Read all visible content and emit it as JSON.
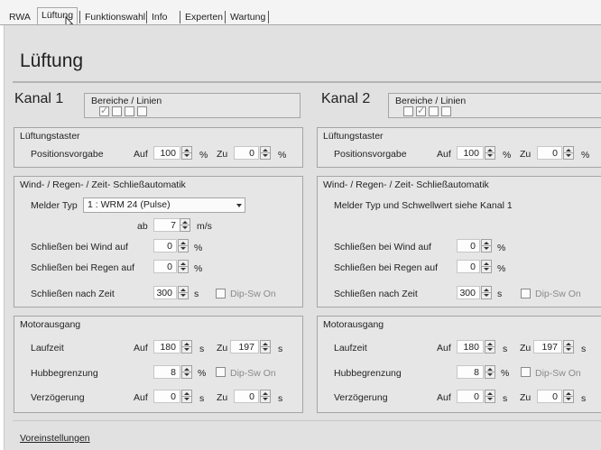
{
  "tabs": [
    "RWA",
    "Lüftung",
    "Funktionswahl",
    "Info",
    "Experten",
    "Wartung"
  ],
  "active_tab": "Lüftung",
  "page_title": "Lüftung",
  "footer_link": "Voreinstellungen",
  "kanal1": {
    "title": "Kanal 1",
    "bereiche_label": "Bereiche / Linien",
    "bereiche_checked": [
      true,
      false,
      false,
      false
    ],
    "lueftungstaster": {
      "title": "Lüftungstaster",
      "positionsvorgabe": "Positionsvorgabe",
      "auf_label": "Auf",
      "auf": "100",
      "auf_unit": "%",
      "zu_label": "Zu",
      "zu": "0",
      "zu_unit": "%"
    },
    "wind": {
      "title": "Wind- / Regen- / Zeit- Schließautomatik",
      "melder_typ_label": "Melder Typ",
      "melder_typ": "1 : WRM 24  (Pulse)",
      "ab_label": "ab",
      "ab": "7",
      "ab_unit": "m/s",
      "wind_label": "Schließen bei Wind auf",
      "wind": "0",
      "wind_unit": "%",
      "regen_label": "Schließen bei Regen auf",
      "regen": "0",
      "regen_unit": "%",
      "zeit_label": "Schließen nach Zeit",
      "zeit": "300",
      "zeit_unit": "s",
      "dip_label": "Dip-Sw On"
    },
    "motor": {
      "title": "Motorausgang",
      "laufzeit_label": "Laufzeit",
      "auf_label": "Auf",
      "zu_label": "Zu",
      "laufzeit_auf": "180",
      "laufzeit_zu": "197",
      "s_unit": "s",
      "hub_label": "Hubbegrenzung",
      "hub": "8",
      "hub_unit": "%",
      "dip_label": "Dip-Sw On",
      "verz_label": "Verzögerung",
      "verz_auf": "0",
      "verz_zu": "0"
    }
  },
  "kanal2": {
    "title": "Kanal 2",
    "bereiche_label": "Bereiche / Linien",
    "bereiche_checked": [
      false,
      true,
      false,
      false
    ],
    "lueftungstaster": {
      "title": "Lüftungstaster",
      "positionsvorgabe": "Positionsvorgabe",
      "auf_label": "Auf",
      "auf": "100",
      "auf_unit": "%",
      "zu_label": "Zu",
      "zu": "0",
      "zu_unit": "%"
    },
    "wind": {
      "title": "Wind- / Regen- / Zeit- Schließautomatik",
      "melder_note": "Melder Typ und Schwellwert siehe Kanal 1",
      "wind_label": "Schließen bei Wind auf",
      "wind": "0",
      "wind_unit": "%",
      "regen_label": "Schließen bei Regen auf",
      "regen": "0",
      "regen_unit": "%",
      "zeit_label": "Schließen nach Zeit",
      "zeit": "300",
      "zeit_unit": "s",
      "dip_label": "Dip-Sw On"
    },
    "motor": {
      "title": "Motorausgang",
      "laufzeit_label": "Laufzeit",
      "auf_label": "Auf",
      "zu_label": "Zu",
      "laufzeit_auf": "180",
      "laufzeit_zu": "197",
      "s_unit": "s",
      "hub_label": "Hubbegrenzung",
      "hub": "8",
      "hub_unit": "%",
      "dip_label": "Dip-Sw On",
      "verz_label": "Verzögerung",
      "verz_auf": "0",
      "verz_zu": "0"
    }
  }
}
